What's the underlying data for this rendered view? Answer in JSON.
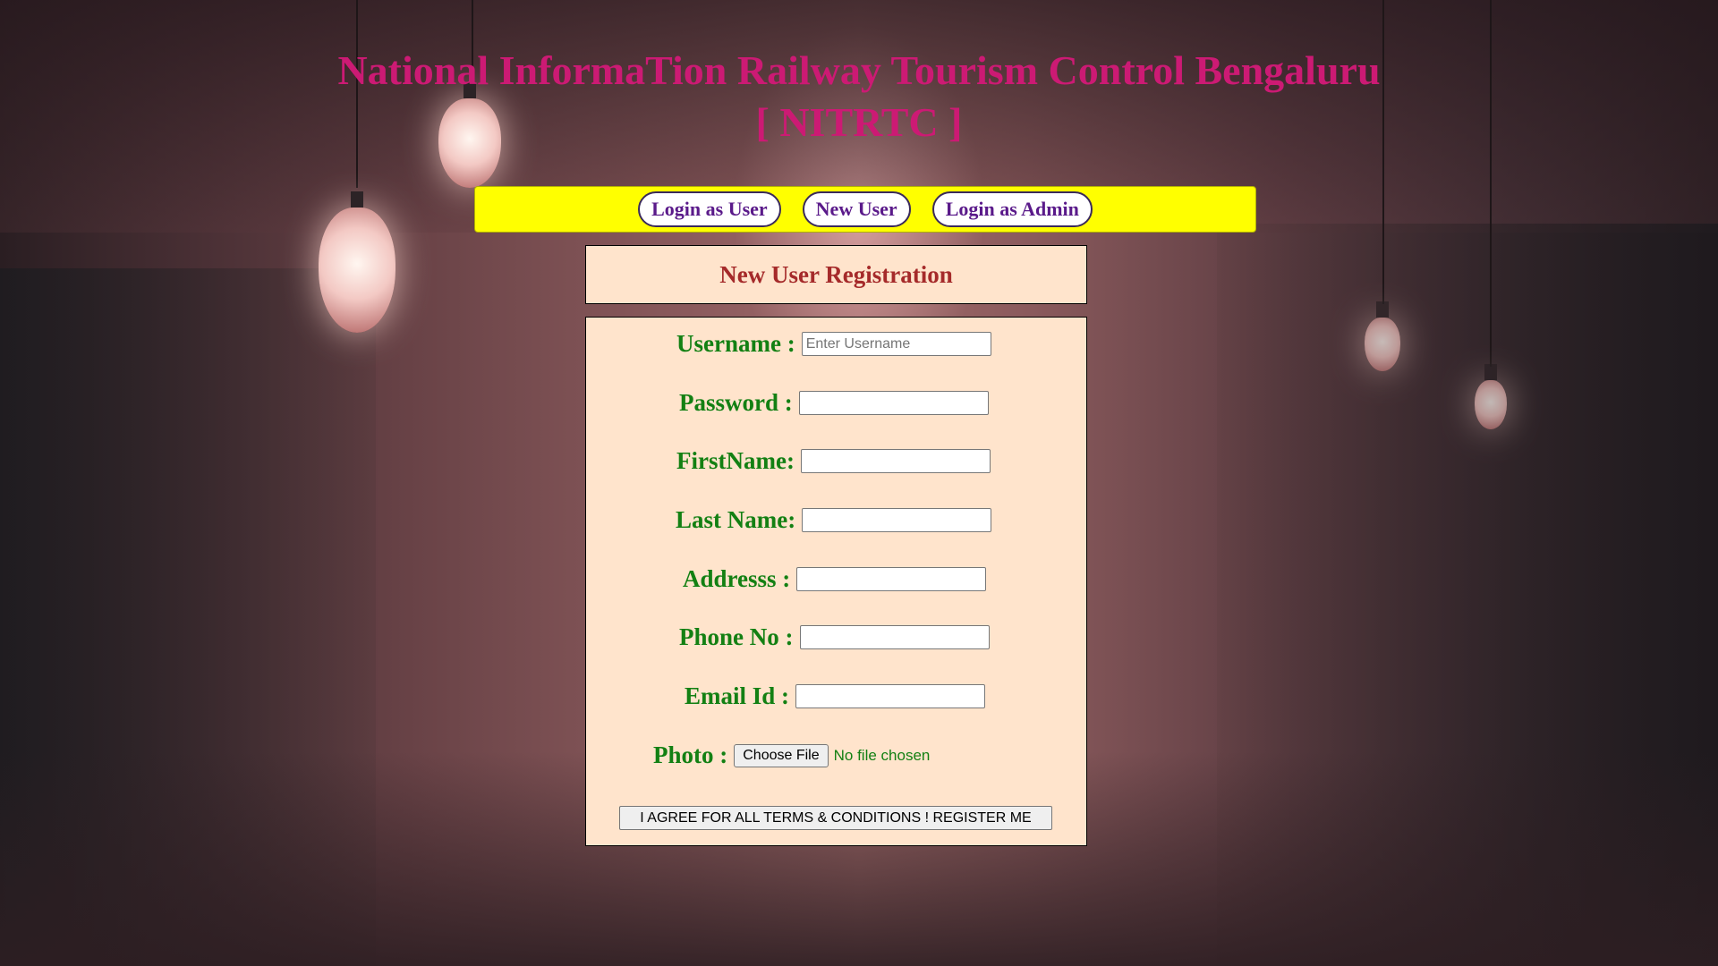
{
  "page": {
    "title_line1": "National InformaTion Railway Tourism Control Bengaluru",
    "title_line2": "[ NITRTC ]"
  },
  "nav": {
    "login_user": "Login as User",
    "new_user": "New User",
    "login_admin": "Login as Admin",
    "bar_color": "#ffff00"
  },
  "registration": {
    "heading": "New User Registration",
    "fields": {
      "username": {
        "label": "Username :",
        "placeholder": "Enter Username",
        "value": ""
      },
      "password": {
        "label": "Password :",
        "value": ""
      },
      "firstname": {
        "label": "FirstName:",
        "value": ""
      },
      "lastname": {
        "label": "Last Name:",
        "value": ""
      },
      "address": {
        "label": "Addresss :",
        "value": ""
      },
      "phone": {
        "label": "Phone No :",
        "value": ""
      },
      "email": {
        "label": "Email Id :",
        "value": ""
      },
      "photo": {
        "label": "Photo :",
        "button": "Choose File",
        "status": "No file chosen"
      }
    },
    "submit": "I AGREE FOR ALL TERMS & CONDITIONS ! REGISTER ME"
  },
  "colors": {
    "title": "#cc1a74",
    "label": "#138013",
    "heading": "#a52a2a",
    "panel": "#ffe4cc",
    "nav_text": "#5a1a8a"
  }
}
